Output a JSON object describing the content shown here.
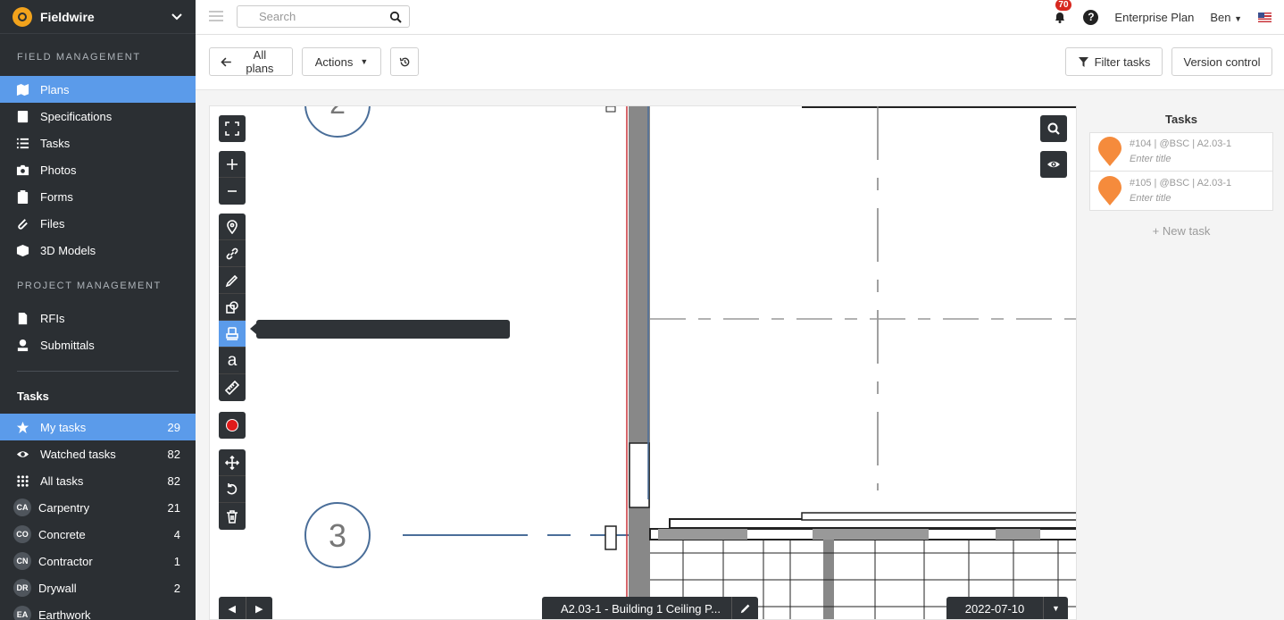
{
  "app": {
    "name": "Fieldwire"
  },
  "sidebar": {
    "field_management_label": "FIELD MANAGEMENT",
    "field_items": [
      {
        "label": "Plans",
        "icon": "plans-icon",
        "active": true
      },
      {
        "label": "Specifications",
        "icon": "specifications-icon"
      },
      {
        "label": "Tasks",
        "icon": "tasks-icon"
      },
      {
        "label": "Photos",
        "icon": "camera-icon"
      },
      {
        "label": "Forms",
        "icon": "clipboard-icon"
      },
      {
        "label": "Files",
        "icon": "paperclip-icon"
      },
      {
        "label": "3D Models",
        "icon": "cube-icon"
      }
    ],
    "project_management_label": "PROJECT MANAGEMENT",
    "project_items": [
      {
        "label": "RFIs",
        "icon": "document-icon"
      },
      {
        "label": "Submittals",
        "icon": "stamp-icon"
      }
    ],
    "tasks_heading": "Tasks",
    "task_filters": [
      {
        "label": "My tasks",
        "count": "29",
        "icon": "star-icon",
        "active": true
      },
      {
        "label": "Watched tasks",
        "count": "82",
        "icon": "eye-icon"
      },
      {
        "label": "All tasks",
        "count": "82",
        "icon": "grid-icon"
      }
    ],
    "categories": [
      {
        "abbr": "CA",
        "label": "Carpentry",
        "count": "21"
      },
      {
        "abbr": "CO",
        "label": "Concrete",
        "count": "4"
      },
      {
        "abbr": "CN",
        "label": "Contractor",
        "count": "1"
      },
      {
        "abbr": "DR",
        "label": "Drywall",
        "count": "2"
      },
      {
        "abbr": "EA",
        "label": "Earthwork",
        "count": ""
      }
    ]
  },
  "topbar": {
    "search_placeholder": "Search",
    "notification_count": "70",
    "plan_label": "Enterprise Plan",
    "user_name": "Ben"
  },
  "toolbar": {
    "all_plans": "All plans",
    "actions": "Actions",
    "filter_tasks": "Filter tasks",
    "version_control": "Version control"
  },
  "plan": {
    "sheet_name": "A2.03-1 - Building 1 Ceiling P...",
    "date": "2022-07-10",
    "grid_labels": [
      "2",
      "3"
    ]
  },
  "tasks_panel": {
    "title": "Tasks",
    "tasks": [
      {
        "meta": "#104 | @BSC | A2.03-1",
        "title": "Enter title"
      },
      {
        "meta": "#105 | @BSC | A2.03-1",
        "title": "Enter title"
      }
    ],
    "new_task": "+ New task"
  },
  "colors": {
    "accent": "#5b9bea",
    "sidebar": "#2b2f33",
    "pin": "#f58b3c",
    "brand": "#f3a31c"
  }
}
